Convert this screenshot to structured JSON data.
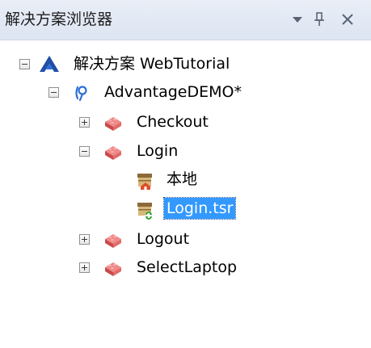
{
  "panel": {
    "title": "解决方案浏览器",
    "dropdown_icon": "dropdown-arrow-icon",
    "pin_icon": "pin-icon",
    "close_icon": "close-icon"
  },
  "tree": {
    "solution": {
      "label": "解决方案 WebTutorial",
      "icon": "solution-icon",
      "expanded": true
    },
    "test": {
      "label": "AdvantageDEMO*",
      "icon": "test-icon",
      "expanded": true
    },
    "actions": [
      {
        "label": "Checkout",
        "icon": "action-icon",
        "expanded": false
      },
      {
        "label": "Login",
        "icon": "action-icon",
        "expanded": true
      },
      {
        "label": "Logout",
        "icon": "action-icon",
        "expanded": false
      },
      {
        "label": "SelectLaptop",
        "icon": "action-icon",
        "expanded": false
      }
    ],
    "login_children": [
      {
        "label": "本地",
        "icon": "local-repository-icon"
      },
      {
        "label": "Login.tsr",
        "icon": "shared-repository-icon",
        "selected": true
      }
    ]
  },
  "colors": {
    "selection": "#3399ff",
    "titlebar": "#dde5f2",
    "action_icon": "#e06a6a",
    "solution_icon": "#1f4fa8"
  }
}
